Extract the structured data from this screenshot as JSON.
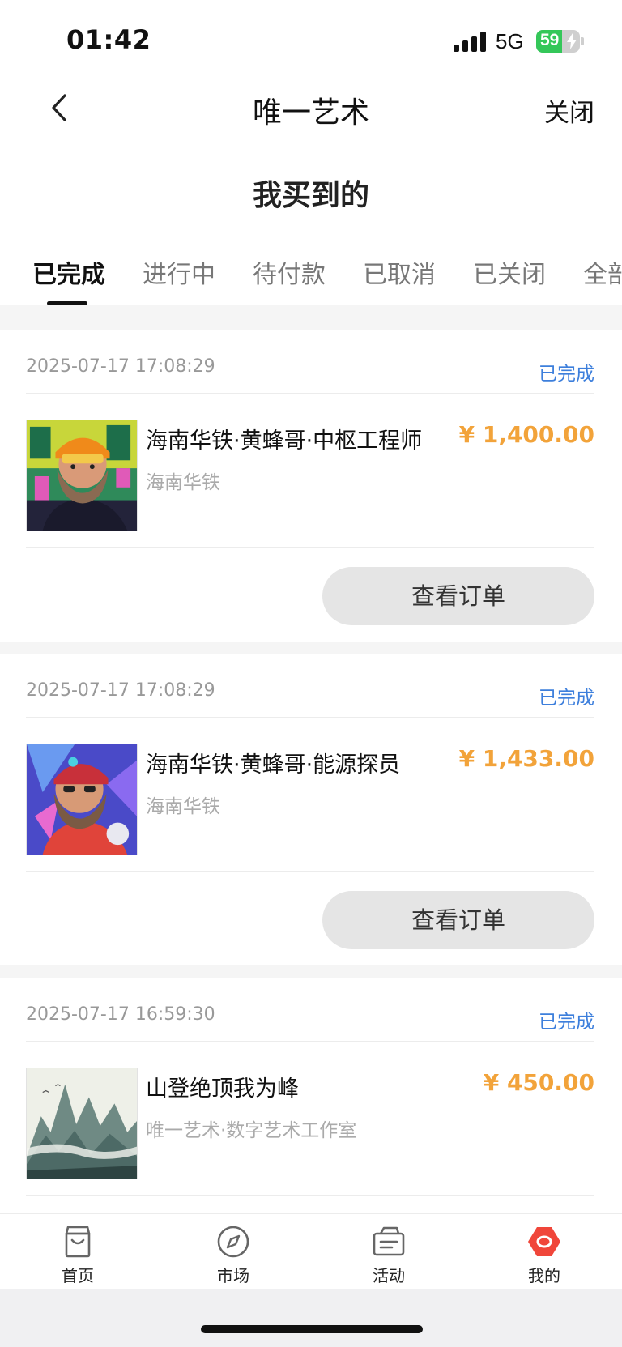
{
  "status_bar": {
    "time": "01:42",
    "network": "5G",
    "battery": "59",
    "battery_level": 0.59
  },
  "nav": {
    "title": "唯一艺术",
    "close_label": "关闭"
  },
  "page_title": "我买到的",
  "tabs": [
    {
      "label": "已完成",
      "active": true
    },
    {
      "label": "进行中"
    },
    {
      "label": "待付款"
    },
    {
      "label": "已取消"
    },
    {
      "label": "已关闭"
    },
    {
      "label": "全部"
    }
  ],
  "orders": [
    {
      "time": "2025-07-17 17:08:29",
      "status": "已完成",
      "name": "海南华铁·黄蜂哥·中枢工程师",
      "shop": "海南华铁",
      "price": "¥ 1,400.00",
      "button": "查看订单",
      "thumb_icon": "bearded-engineer-avatar"
    },
    {
      "time": "2025-07-17 17:08:29",
      "status": "已完成",
      "name": "海南华铁·黄蜂哥·能源探员",
      "shop": "海南华铁",
      "price": "¥ 1,433.00",
      "button": "查看订单",
      "thumb_icon": "bearded-explorer-avatar"
    },
    {
      "time": "2025-07-17 16:59:30",
      "status": "已完成",
      "name": "山登绝顶我为峰",
      "shop": "唯一艺术·数字艺术工作室",
      "price": "¥ 450.00",
      "thumb_icon": "mountain-landscape"
    }
  ],
  "tab_bar": [
    {
      "label": "首页",
      "icon": "bag-icon"
    },
    {
      "label": "市场",
      "icon": "compass-icon"
    },
    {
      "label": "活动",
      "icon": "ticket-icon"
    },
    {
      "label": "我的",
      "icon": "profile-hexagon-icon",
      "active": true
    }
  ],
  "colors": {
    "accent_blue": "#3d7fdc",
    "price_orange": "#f2a33a",
    "tab_active_red": "#f0463a"
  }
}
